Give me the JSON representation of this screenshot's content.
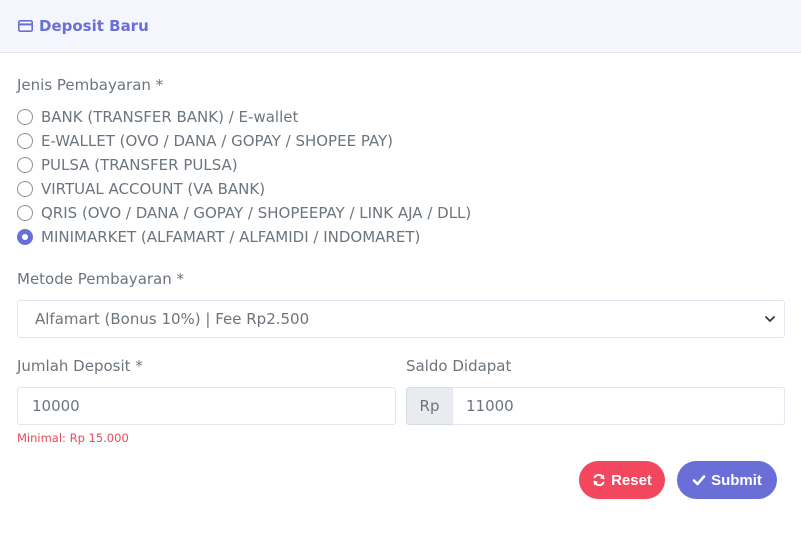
{
  "header": {
    "title": "Deposit Baru",
    "icon": "credit-card-icon"
  },
  "form": {
    "jenis_label": "Jenis Pembayaran *",
    "payment_types": [
      {
        "label": "BANK (TRANSFER BANK) / E-wallet",
        "checked": false
      },
      {
        "label": "E-WALLET (OVO / DANA / GOPAY / SHOPEE PAY)",
        "checked": false
      },
      {
        "label": "PULSA (TRANSFER PULSA)",
        "checked": false
      },
      {
        "label": "VIRTUAL ACCOUNT (VA BANK)",
        "checked": false
      },
      {
        "label": "QRIS (OVO / DANA / GOPAY / SHOPEEPAY / LINK AJA / DLL)",
        "checked": false
      },
      {
        "label": "MINIMARKET (ALFAMART / ALFAMIDI / INDOMARET)",
        "checked": true
      }
    ],
    "metode_label": "Metode Pembayaran *",
    "metode_value": "Alfamart (Bonus 10%) | Fee Rp2.500",
    "jumlah_label": "Jumlah Deposit *",
    "jumlah_value": "10000",
    "jumlah_hint": "Minimal: Rp 15.000",
    "saldo_label": "Saldo Didapat",
    "saldo_prefix": "Rp",
    "saldo_value": "11000"
  },
  "actions": {
    "reset_label": "Reset",
    "submit_label": "Submit"
  },
  "colors": {
    "accent": "#6a6fd7",
    "danger": "#f2475e",
    "hint": "#e74a5b",
    "header_bg": "#f4f5fd"
  }
}
